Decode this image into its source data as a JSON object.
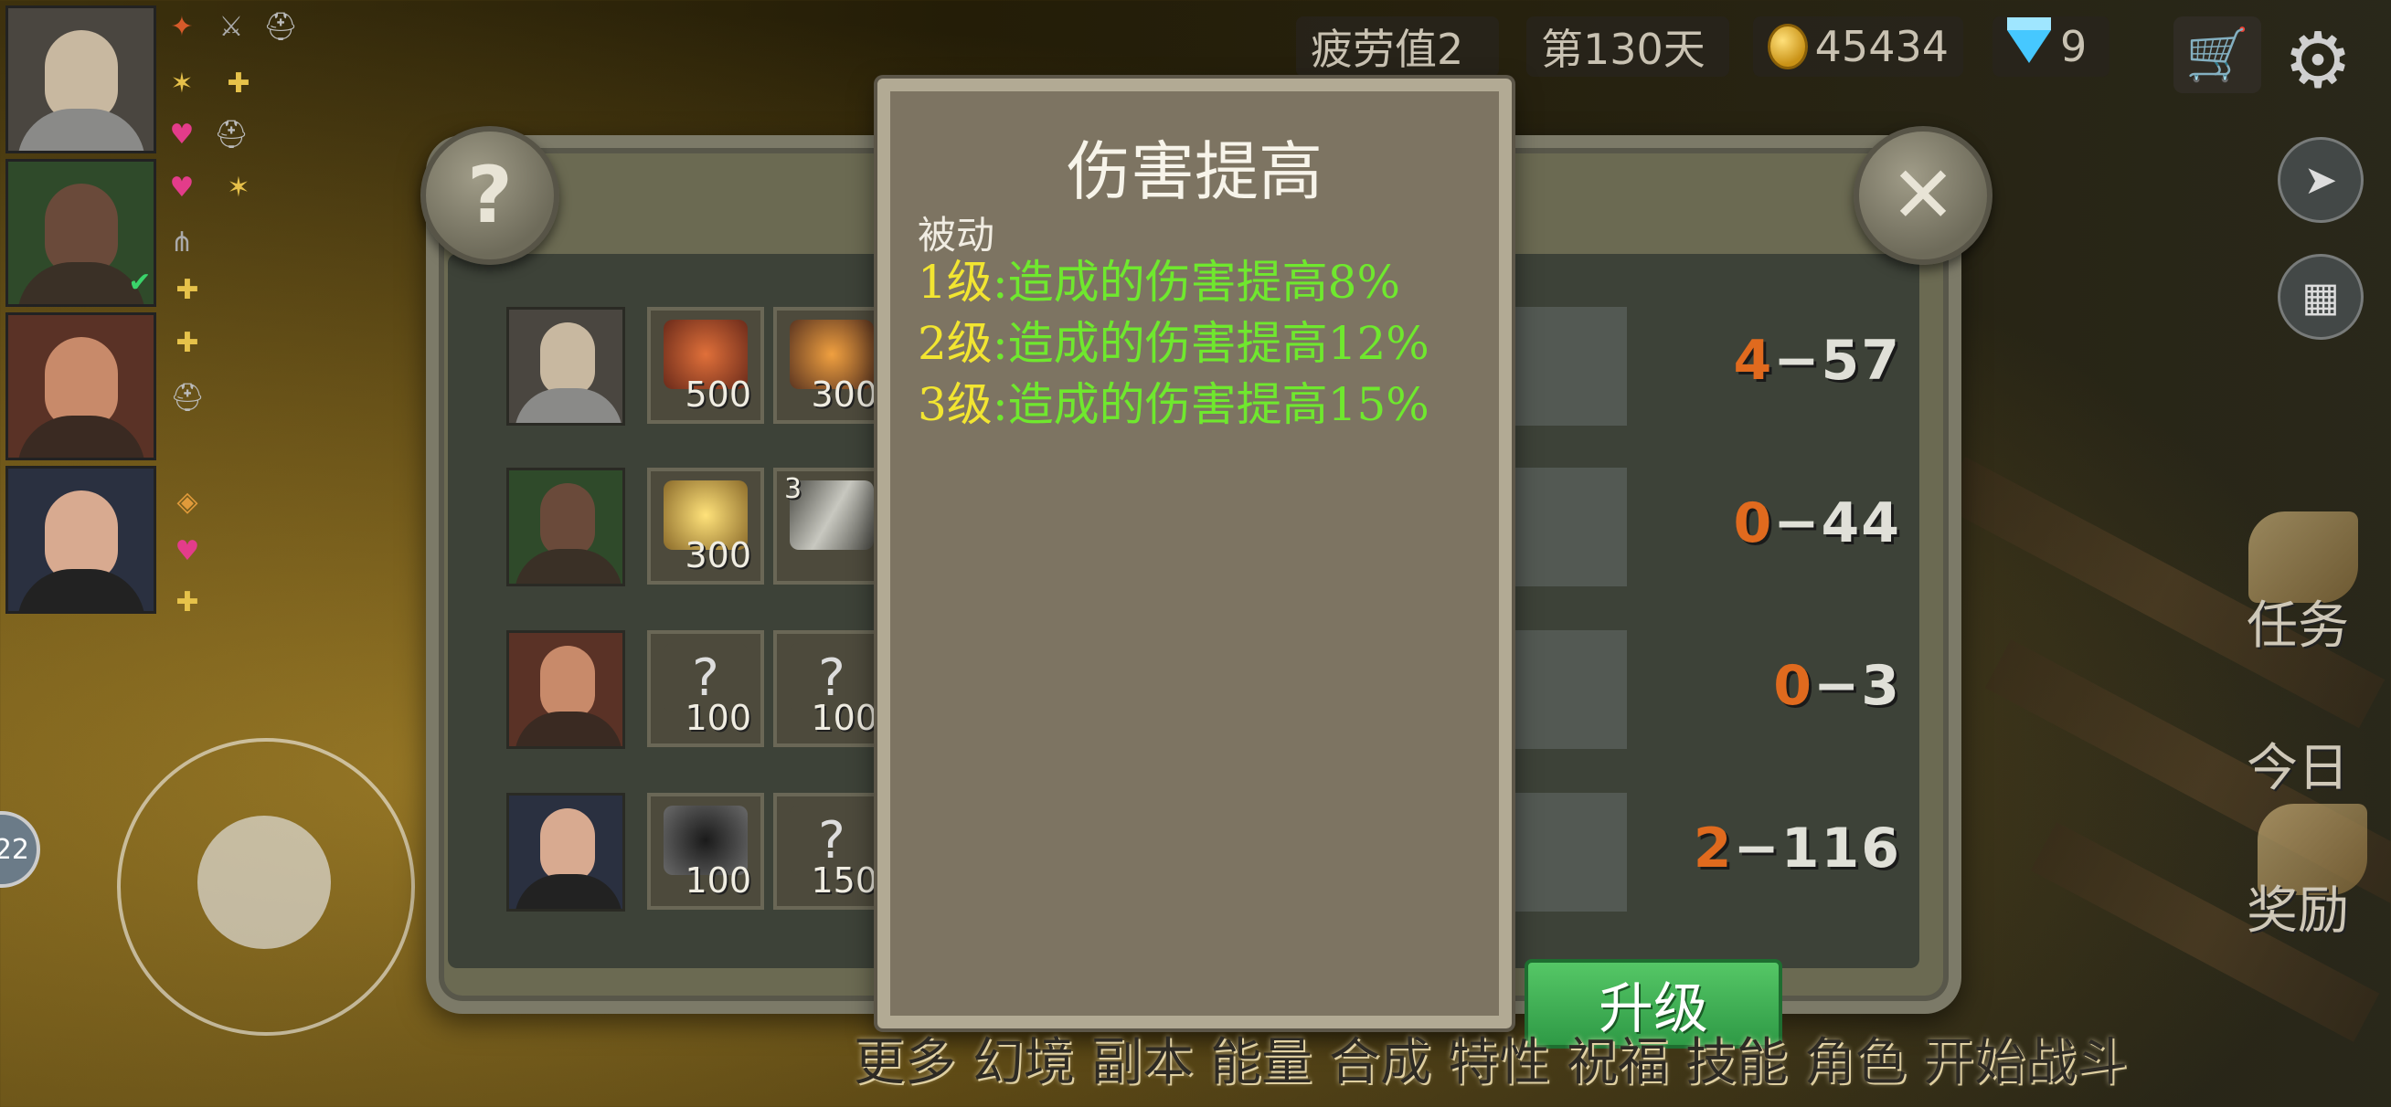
{
  "top_bar": {
    "fatigue": "疲劳值2",
    "day": "第130天",
    "gold": "45434",
    "gems": "9",
    "cart_icon": "shopping-cart-icon",
    "settings_icon": "gear-icon"
  },
  "left_badge": {
    "label": "22"
  },
  "tooltip": {
    "title": "伤害提高",
    "type": "被动",
    "levels": [
      {
        "tag": "1级",
        "text": ":造成的伤害提高8%"
      },
      {
        "tag": "2级",
        "text": ":造成的伤害提高12%"
      },
      {
        "tag": "3级",
        "text": ":造成的伤害提高15%"
      }
    ]
  },
  "rows": [
    {
      "skill_costs": [
        "500",
        "300"
      ],
      "skill_levels": [
        "",
        ""
      ],
      "score_a": "4",
      "score_b": "57"
    },
    {
      "skill_costs": [
        "300",
        ""
      ],
      "skill_levels": [
        "",
        "3"
      ],
      "score_a": "0",
      "score_b": "44"
    },
    {
      "skill_costs": [
        "100",
        "100"
      ],
      "skill_levels": [
        "",
        ""
      ],
      "score_a": "0",
      "score_b": "3"
    },
    {
      "skill_costs": [
        "100",
        "150"
      ],
      "skill_levels": [
        "",
        ""
      ],
      "score_a": "2",
      "score_b": "116"
    }
  ],
  "buttons": {
    "upgrade": "升级",
    "help_icon": "question-icon",
    "close_icon": "close-icon"
  },
  "side_menu": {
    "tasks": "任务",
    "daily": "今日",
    "rewards": "奖励"
  },
  "bottom_menu": [
    "更多",
    "幻境",
    "副本",
    "能量",
    "合成",
    "特性",
    "祝福",
    "技能",
    "角色",
    "开始战斗"
  ],
  "colors": {
    "level_tag": "#f2e531",
    "level_text": "#6fe82e",
    "score_accent": "#e06a1e",
    "upgrade_green": "#3fae55"
  }
}
